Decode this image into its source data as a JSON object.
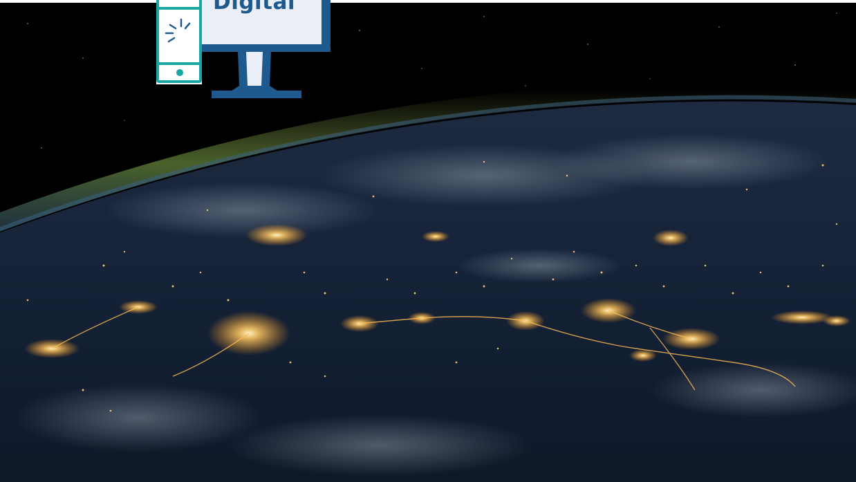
{
  "logo": {
    "wordmark": "Digital",
    "icon": "computer-monitor-phone-icon",
    "colors": {
      "primary": "#1e5a8e",
      "accent": "#1ba6a6",
      "screen": "#e9eef7"
    }
  },
  "hero": {
    "image": "earth-at-night-city-lights",
    "colors": {
      "space": "#000000",
      "ocean": "#16243a",
      "city_lights": "#ffc862"
    }
  }
}
